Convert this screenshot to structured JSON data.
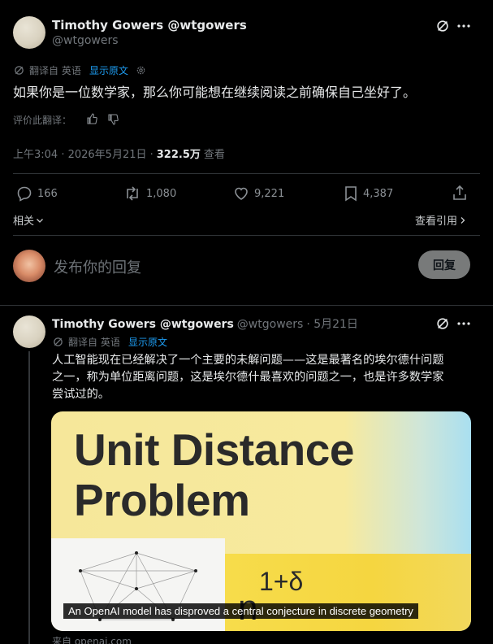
{
  "main_tweet": {
    "name": "Timothy Gowers @wtgowers",
    "handle": "@wtgowers",
    "translated_from": "翻译自 英语",
    "show_original": "显示原文",
    "text": "如果你是一位数学家，那么你可能想在继续阅读之前确保自己坐好了。",
    "rate_translation": "评价此翻译：",
    "time": "上午3:04 · 2026年5月21日 ·",
    "views_count": "322.5万",
    "views_label": "查看",
    "stats": {
      "replies": "166",
      "retweets": "1,080",
      "likes": "9,221",
      "bookmarks": "4,387"
    },
    "related_label": "相关",
    "view_quotes": "查看引用"
  },
  "compose": {
    "placeholder": "发布你的回复",
    "reply_button": "回复"
  },
  "reply_tweet": {
    "name": "Timothy Gowers @wtgowers",
    "handle": "@wtgowers",
    "date": "· 5月21日",
    "translated_from": "翻译自 英语",
    "show_original": "显示原文",
    "text_line1": "人工智能现在已经解决了一个主要的未解问题——这是最著名的埃尔德什问题",
    "text_line2": "之一，称为单位距离问题，这是埃尔德什最喜欢的问题之一，也是许多数学家",
    "text_line3": "尝试过的。",
    "card": {
      "title_line1": "Unit Distance",
      "title_line2": "Problem",
      "formula_base": "n",
      "formula_exp": "1+δ",
      "caption": "An OpenAI model has disproved a central conjecture in discrete geometry",
      "source": "来自 openai.com"
    }
  },
  "colors": {
    "accent": "#1d9bf0",
    "background": "#000000",
    "divider": "#2f3336"
  }
}
